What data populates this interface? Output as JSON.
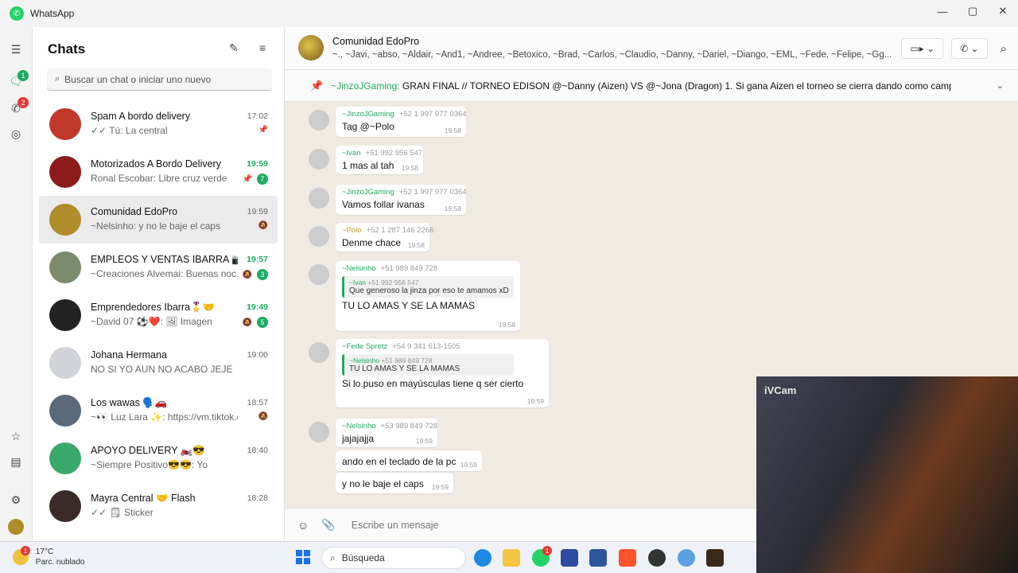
{
  "app": {
    "title": "WhatsApp"
  },
  "window": {
    "minimize": "—",
    "maximize": "▢",
    "close": "✕"
  },
  "rail": {
    "chats_badge": "1",
    "calls_badge": "2"
  },
  "sidebar": {
    "title": "Chats",
    "search_placeholder": "Buscar un chat o iniciar uno nuevo",
    "chats": [
      {
        "name": "Spam A bordo delivery",
        "preview": "✓✓ Tú: La central",
        "time": "17:02",
        "unread": "",
        "pinned": true,
        "muted": false,
        "active": false,
        "color": "#c0392b"
      },
      {
        "name": "Motorizados A Bordo Delivery",
        "preview": "Ronal Escobar: Libre cruz verde",
        "time": "19:59",
        "unread": "7",
        "pinned": true,
        "muted": false,
        "active": false,
        "color": "#8e1b1b"
      },
      {
        "name": "Comunidad EdoPro",
        "preview": "~Nelsinho: y no le baje el caps",
        "time": "19:59",
        "unread": "",
        "pinned": false,
        "muted": true,
        "active": true,
        "color": "#b08d2a"
      },
      {
        "name": "EMPLEOS Y VENTAS IBARRA 📷🔐",
        "preview": "~Creaciones Alvemai: Buenas noc...",
        "time": "19:57",
        "unread": "3",
        "pinned": false,
        "muted": true,
        "active": false,
        "color": "#7a8a6a"
      },
      {
        "name": "Emprendedores Ibarra🎖️🤝",
        "preview": "~David 07 ⚽❤️: 🖼 Imagen",
        "time": "19:49",
        "unread": "5",
        "pinned": false,
        "muted": true,
        "active": false,
        "color": "#222222"
      },
      {
        "name": "Johana Hermana",
        "preview": "NO SI YO AUN NO ACABO JEJE",
        "time": "19:00",
        "unread": "",
        "pinned": false,
        "muted": false,
        "active": false,
        "color": "#d0d4d8"
      },
      {
        "name": "Los wawas 🗣️🚗",
        "preview": "~👀 Luz Lara ✨: https://vm.tiktok.co...",
        "time": "18:57",
        "unread": "",
        "pinned": false,
        "muted": true,
        "active": false,
        "color": "#5a6a7a"
      },
      {
        "name": "APOYO DELIVERY 🏍️😎",
        "preview": "~Siempre Positivo😎😎: Yo",
        "time": "18:40",
        "unread": "",
        "pinned": false,
        "muted": false,
        "active": false,
        "color": "#3aa86b"
      },
      {
        "name": "Mayra Central 🤝 Flash",
        "preview": "✓✓ 🗒 Sticker",
        "time": "18:28",
        "unread": "",
        "pinned": false,
        "muted": false,
        "active": false,
        "color": "#3a2a2a"
      }
    ]
  },
  "chat": {
    "name": "Comunidad EdoPro",
    "members": "~., ~Javi, ~abso, ~Aldair, ~And1, ~Andree, ~Betoxico, ~Brad, ~Carlos, ~Claudio, ~Danny, ~Dariel, ~Diango, ~EML, ~Fede, ~Felipe, ~Gg...",
    "video_icon": "▭▸ ⌄",
    "call_icon": "✆ ⌄",
    "search_icon": "⌕",
    "pinned_author": "~JinzoJGaming:",
    "pinned_text": " GRAN FINAL  // TORNEO EDISON  @~Danny (Aizen) VS @~Jona (Dragon)  1. Si gana Aizen el torneo se cierra dando como campeón a Aize...",
    "messages": [
      {
        "author": "~JinzoJGaming",
        "phone": "+52 1 997 977 0364",
        "text": "Tag @~Polo",
        "time": "19:58",
        "author_color": "#1daa61"
      },
      {
        "author": "~Ivan",
        "phone": "+51 992 956 547",
        "text": "1 mas al tah",
        "time": "19:58",
        "author_color": "#1daa61"
      },
      {
        "author": "~JinzoJGaming",
        "phone": "+52 1 997 977 0364",
        "text": "Vamos follar ivanas",
        "time": "19:58",
        "author_color": "#1daa61"
      },
      {
        "author": "~Polo",
        "phone": "+52 1 287 146 2266",
        "text": "Denme chace",
        "time": "19:58",
        "author_color": "#c9a227"
      },
      {
        "author": "~Nelsinho",
        "phone": "+51 989 849 728",
        "quote_author": "~Ivan",
        "quote_phone": "+51 992 956 547",
        "quote_text": "Que generoso la jinza por eso te amamos xD",
        "text": "TU LO AMAS Y SE LA MAMAS",
        "time": "19:58",
        "author_color": "#1daa61"
      },
      {
        "author": "~Fede Spretz",
        "phone": "+54 9 341 613-1505",
        "quote_author": "~Nelsinho",
        "quote_phone": "+51 989 849 728",
        "quote_text": "TU LO AMAS Y SE LA MAMAS",
        "text": "Si lo.puso en mayúsculas tiene q ser cierto",
        "time": "19:59",
        "author_color": "#1daa61"
      },
      {
        "author": "~Nelsinho",
        "phone": "+53 989 849 728",
        "text": "jajajajja",
        "time": "19:59",
        "author_color": "#1daa61"
      },
      {
        "text": "ando en el teclado de la pc",
        "time": "19:59"
      },
      {
        "text": "y no le baje el caps",
        "time": "19:59"
      }
    ],
    "composer_placeholder": "Escribe un mensaje"
  },
  "overlay": {
    "label": "iVCam"
  },
  "taskbar": {
    "temp": "17°C",
    "weather": "Parc. nublado",
    "weather_badge": "1",
    "search_label": "Búsqueda",
    "whatsapp_badge": "1"
  }
}
